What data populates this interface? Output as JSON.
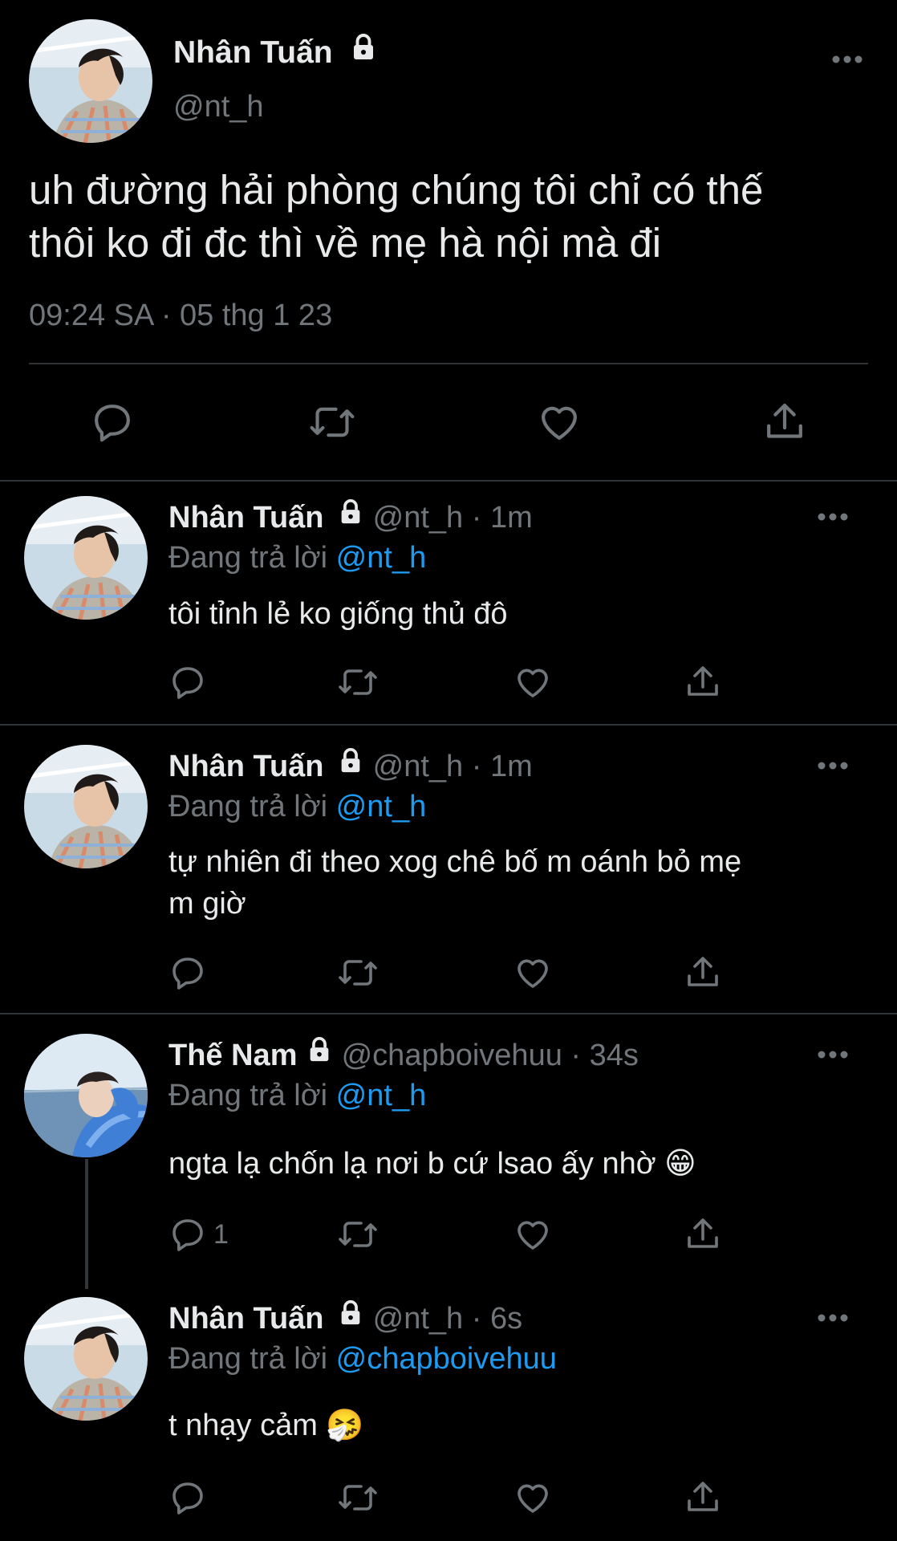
{
  "main_tweet": {
    "name": "Nhân Tuấn",
    "handle": "@nt_h",
    "text_line1": "uh đường hải phòng chúng tôi chỉ có thế",
    "text_line2": "thôi ko đi đc thì về mẹ hà nội mà đi",
    "time": "09:24 SA",
    "dot": "·",
    "date": "05 thg 1 23"
  },
  "replies": [
    {
      "name": "Nhân Tuấn",
      "handle": "@nt_h",
      "time": "· 1m",
      "replying_prefix": "Đang trả lời",
      "replying_to": "@nt_h",
      "text_lines": [
        "tôi tỉnh lẻ ko giống thủ đô"
      ],
      "reply_count": ""
    },
    {
      "name": "Nhân Tuấn",
      "handle": "@nt_h",
      "time": "· 1m",
      "replying_prefix": "Đang trả lời",
      "replying_to": "@nt_h",
      "text_lines": [
        "tự nhiên đi theo xog chê bố m oánh bỏ mẹ",
        "m giờ"
      ],
      "reply_count": ""
    },
    {
      "name": "Thế Nam",
      "handle": "@chapboivehuu",
      "time": "· 34s",
      "replying_prefix": "Đang trả lời",
      "replying_to": "@nt_h",
      "text_lines": [
        "ngta lạ chốn lạ nơi b cứ lsao ấy nhờ 😁"
      ],
      "reply_count": "1"
    },
    {
      "name": "Nhân Tuấn",
      "handle": "@nt_h",
      "time": "· 6s",
      "replying_prefix": "Đang trả lời",
      "replying_to": "@chapboivehuu",
      "text_lines": [
        "t nhạy cảm 🤧"
      ],
      "reply_count": ""
    }
  ],
  "icons": {
    "reply": "reply-icon",
    "retweet": "retweet-icon",
    "like": "heart-icon",
    "share": "share-icon",
    "more": "more-icon",
    "lock": "lock-icon"
  },
  "colors": {
    "background": "#000000",
    "text": "#e7e9ea",
    "secondary": "#71767b",
    "link": "#1d9bf0",
    "divider": "#2f3336"
  }
}
